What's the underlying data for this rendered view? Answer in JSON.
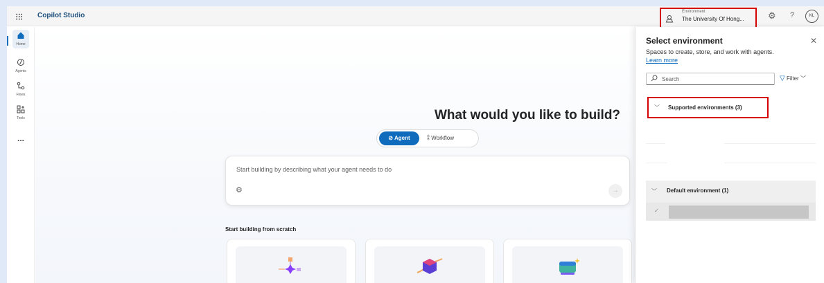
{
  "topbar": {
    "waffle_icon": "⁝⁝⁝",
    "app_title": "Copilot Studio",
    "environment_label": "Environment",
    "environment_name": "The University Of Hong...",
    "avatar_initials": "KL"
  },
  "rail": {
    "items": [
      {
        "label": "Home",
        "icon": "home-icon"
      },
      {
        "label": "Agents",
        "icon": "agents-icon"
      },
      {
        "label": "Flows",
        "icon": "flows-icon"
      },
      {
        "label": "Tools",
        "icon": "tools-icon"
      },
      {
        "label": "...",
        "icon": "more-icon"
      }
    ]
  },
  "main": {
    "heading": "What would you like to build?",
    "tab_agent": "Agent",
    "tab_workflow": "Workflow",
    "prompt_placeholder": "Start building by describing what your agent needs to do",
    "section_title": "Start building from scratch"
  },
  "panel": {
    "title": "Select environment",
    "description": "Spaces to create, store, and work with agents.",
    "learn_more": "Learn more",
    "search_placeholder": "Search",
    "filter_label": "Filter",
    "supported_label": "Supported environments (3)",
    "default_label": "Default environment (1)"
  },
  "colors": {
    "accent": "#0f6cbd",
    "highlight_box": "#d50000",
    "app_title": "#1d4f7c"
  }
}
